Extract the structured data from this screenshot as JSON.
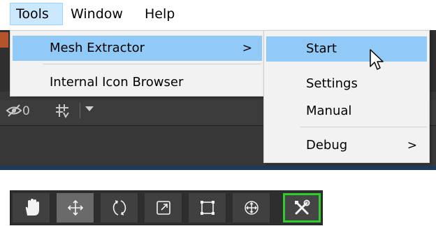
{
  "menubar": {
    "tools": "Tools",
    "window": "Window",
    "help": "Help"
  },
  "scene_toolbar": {
    "hidden_count": "0"
  },
  "tools_menu": {
    "items": [
      {
        "label": "Mesh Extractor",
        "submenu_arrow": ">"
      },
      {
        "label": "Internal Icon Browser"
      }
    ]
  },
  "mesh_extractor_submenu": {
    "items": [
      {
        "label": "Start"
      },
      {
        "label": "Settings"
      },
      {
        "label": "Manual"
      },
      {
        "label": "Debug",
        "submenu_arrow": ">"
      }
    ]
  },
  "tool_buttons": [
    {
      "icon": "hand-icon"
    },
    {
      "icon": "move-icon",
      "state": "active"
    },
    {
      "icon": "rotate-icon"
    },
    {
      "icon": "scale-icon"
    },
    {
      "icon": "rect-icon"
    },
    {
      "icon": "transform-icon"
    },
    {
      "icon": "custom-tools-icon",
      "highlight": "#2ecc2e"
    }
  ],
  "colors": {
    "menu_highlight": "#91c9f7",
    "menubar_active": "#cce8ff",
    "custom_tool_outline": "#2ecc2e"
  }
}
